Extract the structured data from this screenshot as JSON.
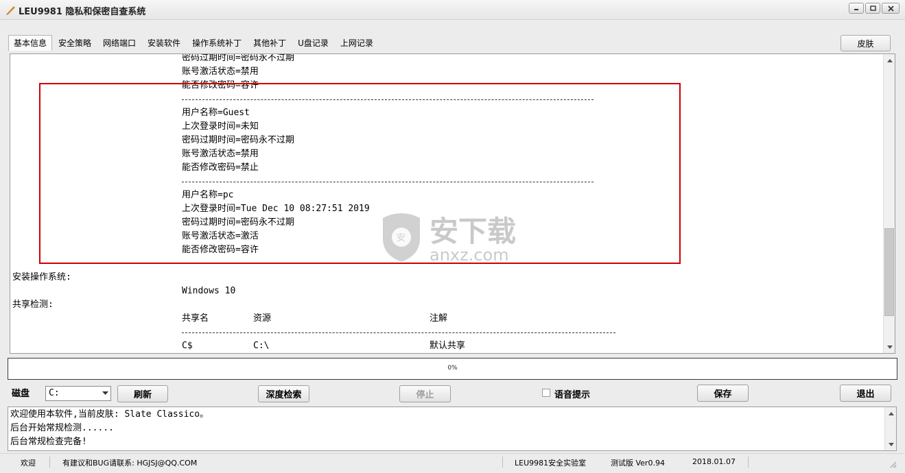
{
  "window": {
    "title": "LEU9981 隐私和保密自查系统",
    "buttons": [
      "minimize",
      "maximize",
      "close"
    ]
  },
  "tabs": [
    "基本信息",
    "安全策略",
    "网络端口",
    "安装软件",
    "操作系统补丁",
    "其他补丁",
    "U盘记录",
    "上网记录"
  ],
  "active_tab": "基本信息",
  "skin_button": "皮肤",
  "content": {
    "lines": [
      "密码过期时间=密码永不过期",
      "账号激活状态=禁用",
      "能否修改密码=容许",
      "用户名称=Guest",
      "上次登录时间=未知",
      "密码过期时间=密码永不过期",
      "账号激活状态=禁用",
      "能否修改密码=禁止",
      "用户名称=pc",
      "上次登录时间=Tue Dec 10 08:27:51 2019",
      "密码过期时间=密码永不过期",
      "账号激活状态=激活",
      "能否修改密码=容许",
      "安装操作系统:",
      "Windows 10",
      "共享检测:",
      "共享名",
      "资源",
      "注解",
      "C$",
      "C:\\",
      "默认共享"
    ]
  },
  "watermark": {
    "logo_text": "安下载",
    "domain": "anxz.com"
  },
  "progress": {
    "value": 0,
    "label": "0%"
  },
  "controls": {
    "disk_label": "磁盘",
    "disk_value": "C:",
    "refresh": "刷新",
    "deep_scan": "深度检索",
    "stop": "停止",
    "voice_prompt": "语音提示",
    "save": "保存",
    "exit": "退出"
  },
  "log": [
    "欢迎使用本软件,当前皮肤: Slate Classico。",
    "后台开始常规检测......",
    "后台常规检查完备!"
  ],
  "status": {
    "welcome": "欢迎",
    "contact": "有建议和BUG请联系: HGJSJ@QQ.COM",
    "lab": "LEU9981安全实验室",
    "version": "测试版 Ver0.94",
    "date": "2018.01.07"
  }
}
